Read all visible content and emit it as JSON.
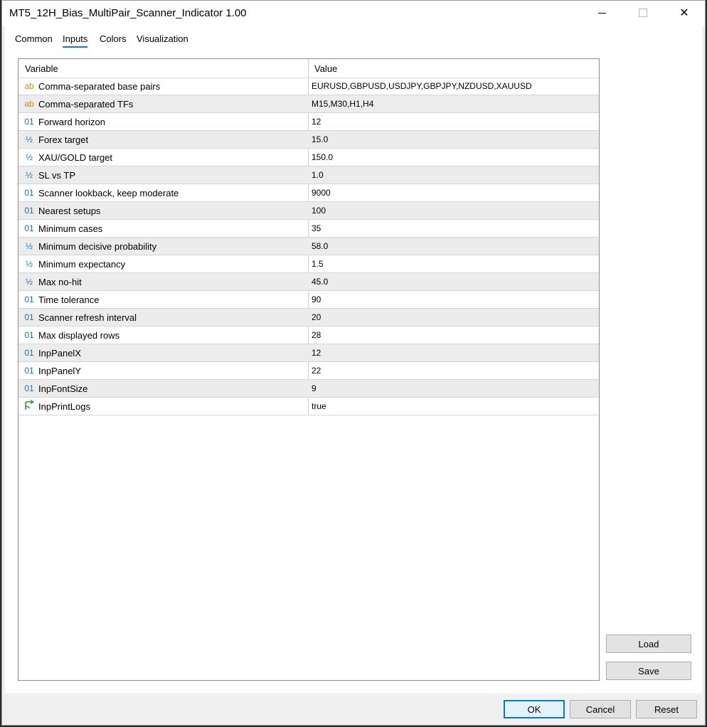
{
  "window": {
    "title": "MT5_12H_Bias_MultiPair_Scanner_Indicator 1.00",
    "minimize": "minimize",
    "maximize": "maximize",
    "close_glyph": "✕"
  },
  "tabs": [
    {
      "label": "Common",
      "active": false
    },
    {
      "label": "Inputs",
      "active": true
    },
    {
      "label": "Colors",
      "active": false
    },
    {
      "label": "Visualization",
      "active": false
    }
  ],
  "grid": {
    "columns": {
      "variable": "Variable",
      "value": "Value"
    },
    "rows": [
      {
        "type": "string",
        "icon": "ab",
        "name": "Comma-separated base pairs",
        "value": "EURUSD,GBPUSD,USDJPY,GBPJPY,NZDUSD,XAUUSD"
      },
      {
        "type": "string",
        "icon": "ab",
        "name": "Comma-separated TFs",
        "value": "M15,M30,H1,H4"
      },
      {
        "type": "int",
        "icon": "01",
        "name": "Forward horizon",
        "value": "12"
      },
      {
        "type": "double",
        "icon": "½",
        "name": "Forex target",
        "value": "15.0"
      },
      {
        "type": "double",
        "icon": "½",
        "name": "XAU/GOLD target",
        "value": "150.0"
      },
      {
        "type": "double",
        "icon": "½",
        "name": "SL vs TP",
        "value": "1.0"
      },
      {
        "type": "int",
        "icon": "01",
        "name": "Scanner lookback, keep moderate",
        "value": "9000"
      },
      {
        "type": "int",
        "icon": "01",
        "name": "Nearest setups",
        "value": "100"
      },
      {
        "type": "int",
        "icon": "01",
        "name": "Minimum cases",
        "value": "35"
      },
      {
        "type": "double",
        "icon": "½",
        "name": "Minimum decisive probability",
        "value": "58.0"
      },
      {
        "type": "double",
        "icon": "½",
        "name": "Minimum expectancy",
        "value": "1.5"
      },
      {
        "type": "double",
        "icon": "½",
        "name": "Max no-hit",
        "value": "45.0"
      },
      {
        "type": "int",
        "icon": "01",
        "name": "Time tolerance",
        "value": "90"
      },
      {
        "type": "int",
        "icon": "01",
        "name": "Scanner refresh interval",
        "value": "20"
      },
      {
        "type": "int",
        "icon": "01",
        "name": "Max displayed rows",
        "value": "28"
      },
      {
        "type": "int",
        "icon": "01",
        "name": "InpPanelX",
        "value": "12"
      },
      {
        "type": "int",
        "icon": "01",
        "name": "InpPanelY",
        "value": "22"
      },
      {
        "type": "int",
        "icon": "01",
        "name": "InpFontSize",
        "value": "9"
      },
      {
        "type": "bool",
        "icon": "bool-arrow-icon",
        "name": "InpPrintLogs",
        "value": "true"
      }
    ]
  },
  "side_buttons": {
    "load": "Load",
    "save": "Save"
  },
  "footer": {
    "ok": "OK",
    "cancel": "Cancel",
    "reset": "Reset"
  },
  "colors": {
    "accent": "#0078d7",
    "tab_underline": "#1e73be",
    "string_icon": "#c98b14",
    "number_icon": "#1f6fb5",
    "bool_icon": "#2a9d3a"
  }
}
